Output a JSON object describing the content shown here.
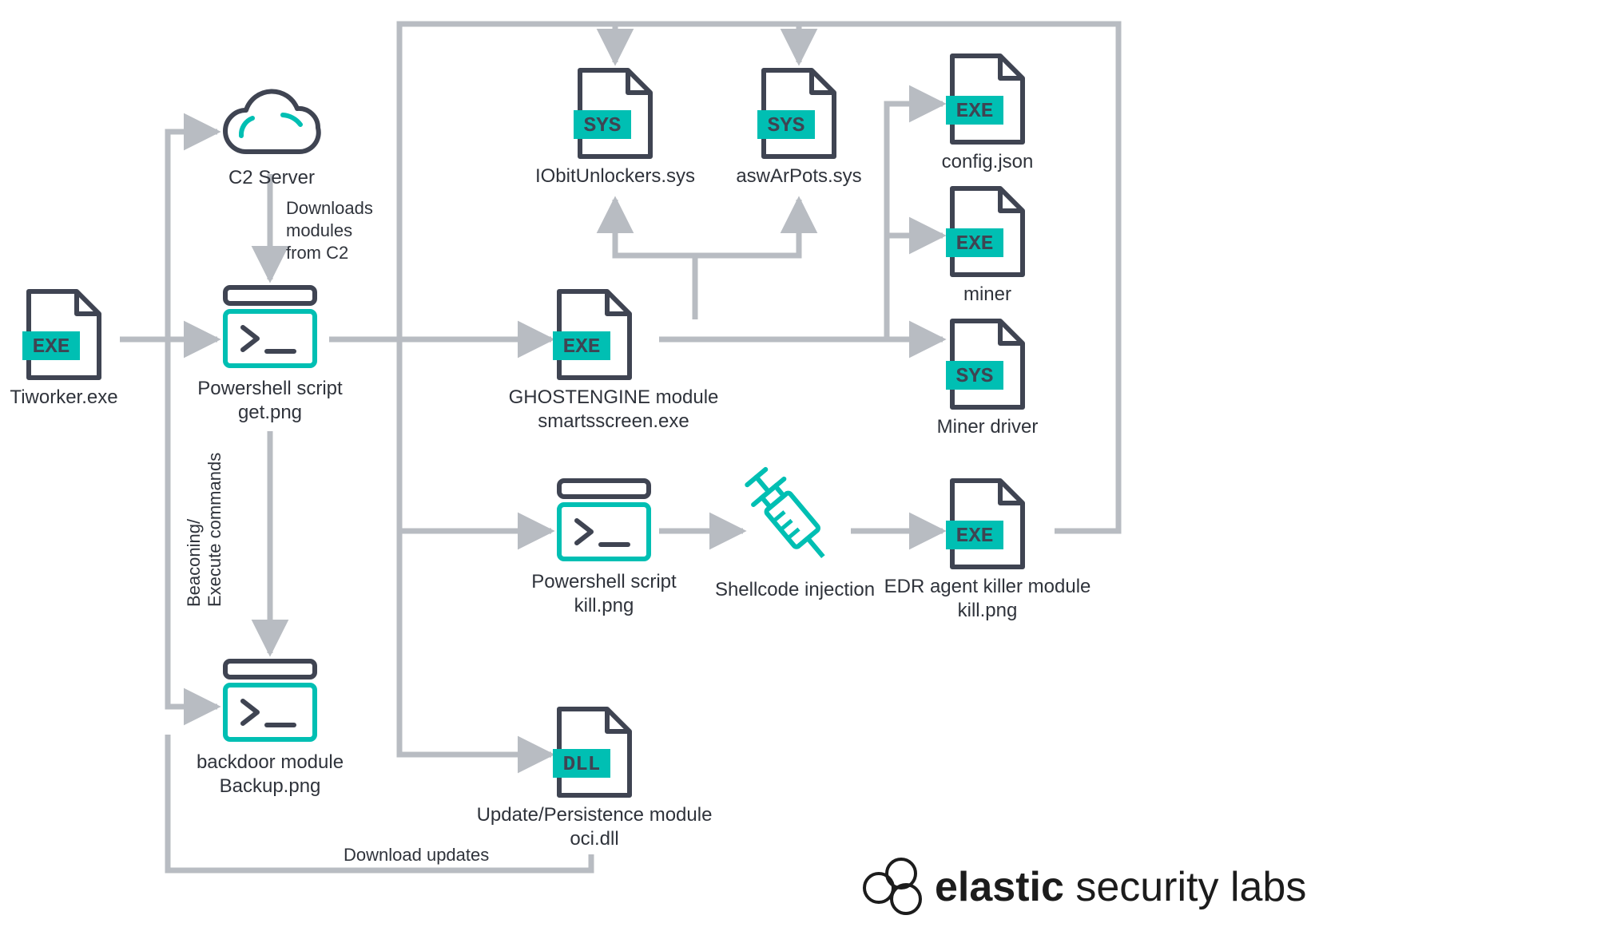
{
  "colors": {
    "teal": "#00BFB3",
    "slate": "#3F4452",
    "fileStroke": "#3F4452",
    "edge": "#b8bcc2",
    "text": "#2f333b"
  },
  "nodes": {
    "tiworker": {
      "label1": "Tiworker.exe",
      "badge": "EXE"
    },
    "c2": {
      "label1": "C2 Server"
    },
    "getpng": {
      "label1": "Powershell script",
      "label2": "get.png"
    },
    "backup": {
      "label1": "backdoor module",
      "label2": "Backup.png"
    },
    "iobit": {
      "label1": "IObitUnlockers.sys",
      "badge": "SYS"
    },
    "aswar": {
      "label1": "aswArPots.sys",
      "badge": "SYS"
    },
    "ghost": {
      "label1": "GHOSTENGINE module",
      "label2": "smartsscreen.exe",
      "badge": "EXE"
    },
    "killpng": {
      "label1": "Powershell script",
      "label2": "kill.png"
    },
    "shellcode": {
      "label1": "Shellcode injection"
    },
    "oci": {
      "label1": "Update/Persistence module",
      "label2": "oci.dll",
      "badge": "DLL"
    },
    "config": {
      "label1": "config.json",
      "badge": "EXE"
    },
    "miner": {
      "label1": "miner",
      "badge": "EXE"
    },
    "minerdriver": {
      "label1": "Miner driver",
      "badge": "SYS"
    },
    "edr": {
      "label1": "EDR agent killer module",
      "label2": "kill.png",
      "badge": "EXE"
    }
  },
  "edge_labels": {
    "downloads": {
      "l1": "Downloads",
      "l2": "modules",
      "l3": "from C2"
    },
    "beaconing": {
      "l1": "Beaconing/",
      "l2": "Execute commands"
    },
    "download_updates": "Download updates"
  },
  "logo": {
    "main": "elastic",
    "sub": " security labs"
  }
}
